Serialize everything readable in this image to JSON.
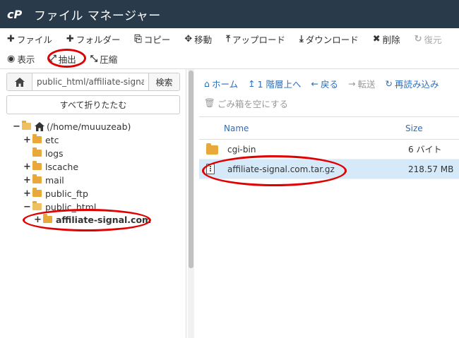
{
  "title_bar": {
    "app_title": "ファイル マネージャー",
    "logo_text": "cP"
  },
  "toolbar": {
    "row1": [
      {
        "icon": "plus-icon",
        "glyph": "✚",
        "label": "ファイル",
        "enabled": true
      },
      {
        "icon": "plus-icon",
        "glyph": "✚",
        "label": "フォルダー",
        "enabled": true
      },
      {
        "icon": "copy-icon",
        "glyph": "⎘",
        "label": "コピー",
        "enabled": true
      },
      {
        "icon": "move-icon",
        "glyph": "✥",
        "label": "移動",
        "enabled": true
      },
      {
        "icon": "upload-icon",
        "glyph": "⤒",
        "label": "アップロード",
        "enabled": true
      },
      {
        "icon": "download-icon",
        "glyph": "⤓",
        "label": "ダウンロード",
        "enabled": true
      },
      {
        "icon": "delete-icon",
        "glyph": "✖",
        "label": "削除",
        "enabled": true
      },
      {
        "icon": "restore-icon",
        "glyph": "↻",
        "label": "復元",
        "enabled": false
      }
    ],
    "row2": [
      {
        "icon": "eye-icon",
        "glyph": "◉",
        "label": "表示",
        "enabled": true
      },
      {
        "icon": "extract-icon",
        "glyph": "⤢",
        "label": "抽出",
        "enabled": true
      },
      {
        "icon": "compress-icon",
        "glyph": "⤡",
        "label": "圧縮",
        "enabled": true
      }
    ]
  },
  "left_pane": {
    "path_value": "public_html/affiliate-signal",
    "go_label": "検索",
    "collapse_all_label": "すべて折りたたむ",
    "tree": [
      {
        "toggle": "−",
        "label": "(/home/muuuzeab)",
        "type": "home",
        "bold": false
      },
      {
        "toggle": "+",
        "label": "etc",
        "type": "folder",
        "bold": false
      },
      {
        "toggle": "",
        "label": "logs",
        "type": "folder",
        "bold": false
      },
      {
        "toggle": "+",
        "label": "lscache",
        "type": "folder",
        "bold": false
      },
      {
        "toggle": "+",
        "label": "mail",
        "type": "folder",
        "bold": false
      },
      {
        "toggle": "+",
        "label": "public_ftp",
        "type": "folder",
        "bold": false
      },
      {
        "toggle": "−",
        "label": "public_html",
        "type": "folder-open",
        "bold": false
      },
      {
        "toggle": "+",
        "label": "affiliate-signal.com",
        "type": "folder",
        "bold": true
      }
    ]
  },
  "right_pane": {
    "nav_row1": [
      {
        "icon": "home-icon",
        "glyph": "⌂",
        "label": "ホーム",
        "enabled": true
      },
      {
        "icon": "up-arrow-icon",
        "glyph": "↥",
        "label": "1 階層上へ",
        "enabled": true
      },
      {
        "icon": "back-arrow-icon",
        "glyph": "←",
        "label": "戻る",
        "enabled": true
      },
      {
        "icon": "forward-arrow-icon",
        "glyph": "→",
        "label": "転送",
        "enabled": false
      },
      {
        "icon": "reload-icon",
        "glyph": "↻",
        "label": "再読み込み",
        "enabled": true
      }
    ],
    "empty_trash_label": "ごみ箱を空にする",
    "columns": {
      "name": "Name",
      "size": "Size"
    },
    "files": [
      {
        "name": "cgi-bin",
        "size": "6 バイト",
        "type": "folder",
        "selected": false
      },
      {
        "name": "affiliate-signal.com.tar.gz",
        "size": "218.57 MB",
        "type": "archive",
        "selected": true
      }
    ]
  },
  "colors": {
    "title_bar_bg": "#293a4a",
    "link_blue": "#2a6ebb",
    "folder_orange": "#e8a93a",
    "selected_row_bg": "#d6e9f8",
    "annotation_red": "#e00000"
  }
}
